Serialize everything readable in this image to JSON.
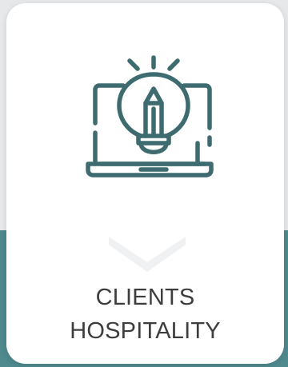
{
  "card": {
    "icon": "laptop-lightbulb-pencil-icon",
    "indicator_icon": "chevron-down-icon",
    "title_line1": "CLIENTS",
    "title_line2": "HOSPITALITY"
  },
  "colors": {
    "icon_stroke": "#3e6b6f",
    "background_top": "#e6e8ea",
    "background_bottom": "#4f8a8e",
    "card": "#ffffff",
    "chevron": "#f0f1f2",
    "text": "#3d3d3d"
  }
}
